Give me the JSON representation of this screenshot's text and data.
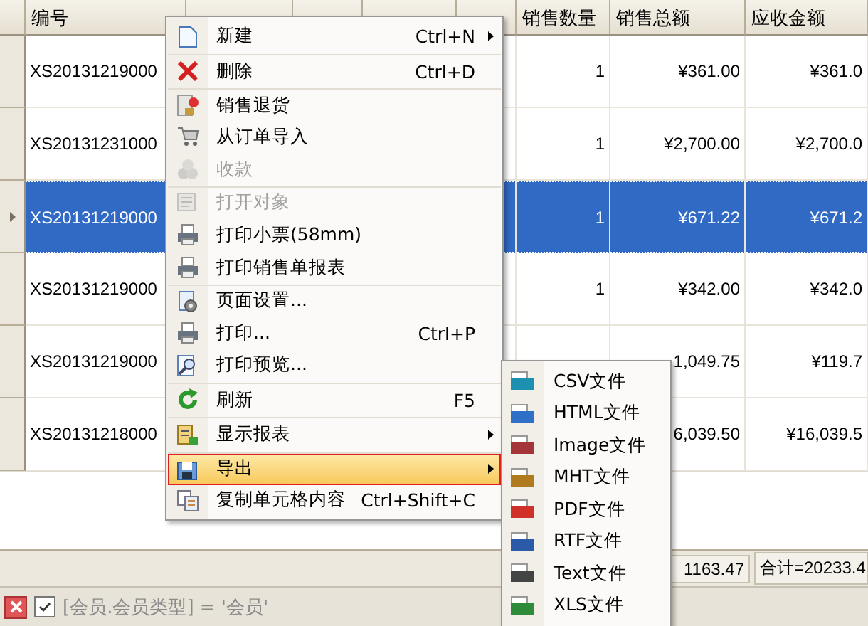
{
  "table": {
    "columns": [
      "编号",
      "销售数量",
      "销售总额",
      "应收金额"
    ],
    "rows": [
      {
        "selected": false,
        "code": "XS20131219000",
        "quantity": "1",
        "total": "¥361.00",
        "receivable": "¥361.0"
      },
      {
        "selected": false,
        "code": "XS20131231000",
        "quantity": "1",
        "total": "¥2,700.00",
        "receivable": "¥2,700.0"
      },
      {
        "selected": true,
        "code": "XS20131219000",
        "quantity": "1",
        "total": "¥671.22",
        "receivable": "¥671.2"
      },
      {
        "selected": false,
        "code": "XS20131219000",
        "quantity": "1",
        "total": "¥342.00",
        "receivable": "¥342.0"
      },
      {
        "selected": false,
        "code": "XS20131219000",
        "total": "1,049.75",
        "receivable": "¥119.7"
      },
      {
        "selected": false,
        "code": "XS20131218000",
        "total": "6,039.50",
        "receivable": "¥16,039.5"
      }
    ]
  },
  "summary": [
    "1163.47",
    "合计=20233.4"
  ],
  "filter": {
    "enabled": true,
    "text": "[会员.会员类型] = '会员'"
  },
  "context_menu": {
    "groups": [
      [
        {
          "label": "新建",
          "shortcut": "Ctrl+N",
          "submenu": true,
          "disabled": false,
          "selected": false
        }
      ],
      [
        {
          "label": "删除",
          "shortcut": "Ctrl+D",
          "submenu": false,
          "disabled": false,
          "selected": false
        }
      ],
      [
        {
          "label": "销售退货",
          "submenu": false,
          "disabled": false,
          "selected": false
        },
        {
          "label": "从订单导入",
          "submenu": false,
          "disabled": false,
          "selected": false
        },
        {
          "label": "收款",
          "submenu": false,
          "disabled": true,
          "selected": false
        }
      ],
      [
        {
          "label": "打开对象",
          "submenu": false,
          "disabled": true,
          "selected": false
        },
        {
          "label": "打印小票(58mm)",
          "submenu": false,
          "disabled": false,
          "selected": false
        },
        {
          "label": "打印销售单报表",
          "submenu": false,
          "disabled": false,
          "selected": false
        }
      ],
      [
        {
          "label": "页面设置...",
          "submenu": false,
          "disabled": false,
          "selected": false
        },
        {
          "label": "打印...",
          "shortcut": "Ctrl+P",
          "submenu": false,
          "disabled": false,
          "selected": false
        },
        {
          "label": "打印预览...",
          "submenu": false,
          "disabled": false,
          "selected": false
        }
      ],
      [
        {
          "label": "刷新",
          "shortcut": "F5",
          "submenu": false,
          "disabled": false,
          "selected": false
        }
      ],
      [
        {
          "label": "显示报表",
          "submenu": true,
          "disabled": false,
          "selected": false
        }
      ],
      [
        {
          "label": "导出",
          "submenu": true,
          "disabled": false,
          "selected": true
        },
        {
          "label": "复制单元格内容",
          "shortcut": "Ctrl+Shift+C",
          "submenu": false,
          "disabled": false,
          "selected": false
        }
      ]
    ]
  },
  "export_submenu": [
    {
      "label": "CSV文件",
      "color": "#1d8fb0"
    },
    {
      "label": "HTML文件",
      "color": "#2f6fc8"
    },
    {
      "label": "Image文件",
      "color": "#a3343a"
    },
    {
      "label": "MHT文件",
      "color": "#b07a1e"
    },
    {
      "label": "PDF文件",
      "color": "#d0302a"
    },
    {
      "label": "RTF文件",
      "color": "#2a5aa8"
    },
    {
      "label": "Text文件",
      "color": "#444444"
    },
    {
      "label": "XLS文件",
      "color": "#2e8b3a"
    }
  ]
}
